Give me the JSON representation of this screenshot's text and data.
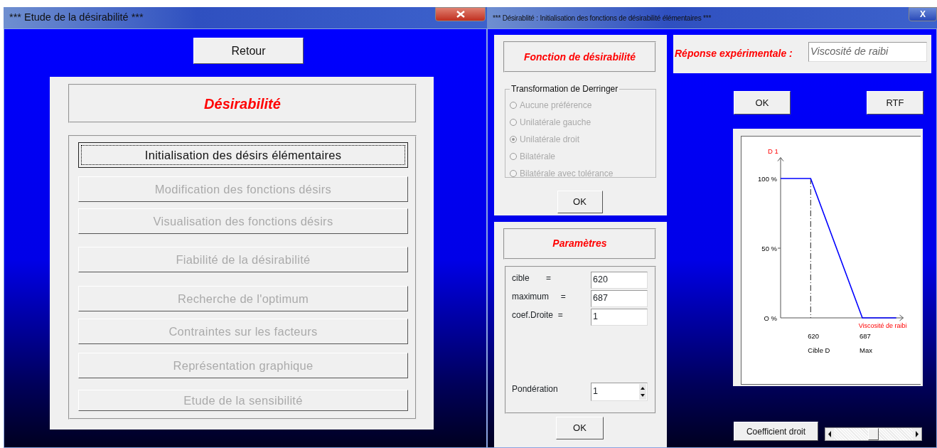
{
  "main_window": {
    "title": "*** Etude de la désirabilité ***",
    "back_button": "Retour",
    "heading": "Désirabilité",
    "menu": [
      {
        "label": "Initialisation des désirs élémentaires",
        "disabled": false,
        "focused": true
      },
      {
        "label": "Modification des fonctions désirs",
        "disabled": true,
        "focused": false
      },
      {
        "label": "Visualisation des fonctions désirs",
        "disabled": true,
        "focused": false
      },
      {
        "label": "Fiabilité de la désirabilité",
        "disabled": true,
        "focused": false
      },
      {
        "label": "Recherche de l'optimum",
        "disabled": true,
        "focused": false
      },
      {
        "label": "Contraintes sur les facteurs",
        "disabled": true,
        "focused": false
      },
      {
        "label": "Représentation graphique",
        "disabled": true,
        "focused": false
      },
      {
        "label": "Etude de la sensibilité",
        "disabled": true,
        "focused": false
      }
    ]
  },
  "init_window": {
    "title": "*** Désirablité : Initialisation des fonctions de désirabilité élémentaires ***",
    "close": "X",
    "function_panel": {
      "heading": "Fonction de désirabilité",
      "group": "Transformation de Derringer",
      "options": [
        {
          "label": "Aucune préférence",
          "selected": false,
          "disabled": true
        },
        {
          "label": "Unilatérale gauche",
          "selected": false,
          "disabled": true
        },
        {
          "label": "Unilatérale droit",
          "selected": true,
          "disabled": true
        },
        {
          "label": "Bilatérale",
          "selected": false,
          "disabled": true
        },
        {
          "label": "Bilatérale avec tolérance",
          "selected": false,
          "disabled": true
        }
      ],
      "ok": "OK"
    },
    "parameters_panel": {
      "heading": "Paramètres",
      "fields": [
        {
          "label": "cible       =",
          "value": "620"
        },
        {
          "label": "maximum     =",
          "value": "687"
        },
        {
          "label": "coef.Droite  =",
          "value": "1"
        }
      ],
      "weight": {
        "label": "Pondération",
        "value": "1"
      },
      "ok": "OK"
    },
    "response": {
      "label": "Réponse expérimentale :",
      "value": "Viscosité de raibi"
    },
    "buttons": [
      "OK",
      "RTF"
    ],
    "chart": {
      "chart_data": {
        "type": "line",
        "ylabel": "D 1",
        "xlabel": "Viscosité de raibi",
        "x": [
          581,
          620,
          687,
          731
        ],
        "series": [
          {
            "color": "#0000ff",
            "values": [
              100,
              100,
              0,
              0
            ]
          }
        ],
        "xlim": [
          581,
          740
        ],
        "ref_lines": [
          {
            "axis": "x",
            "value": 620
          }
        ],
        "ylim": [
          0,
          115
        ],
        "xticks": [
          620,
          687
        ],
        "yticks": [
          {
            "value": 0,
            "label": "O %"
          },
          {
            "value": 50,
            "label": "50 %"
          },
          {
            "value": 100,
            "label": "100 %"
          }
        ],
        "annotations": [
          "Cible D",
          "Max"
        ]
      }
    },
    "coefficient_button": "Coefficient droit",
    "coefficient_slider": {
      "level": 0.5
    }
  }
}
